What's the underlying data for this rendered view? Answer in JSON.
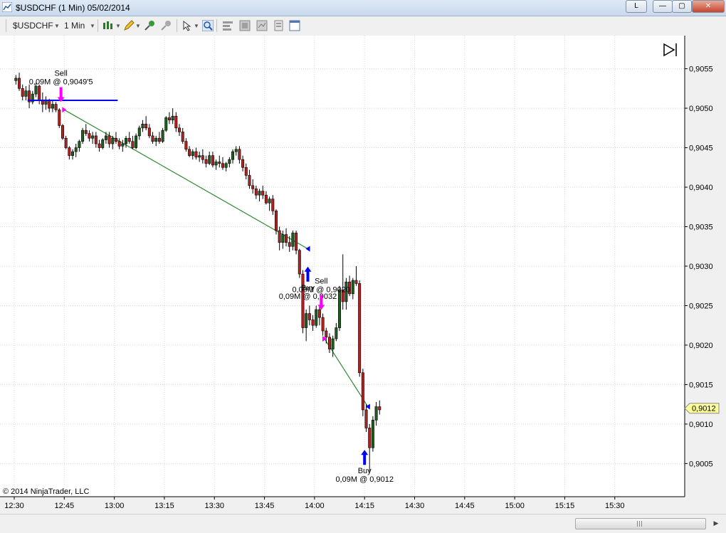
{
  "window": {
    "title": "$USDCHF (1 Min)  05/02/2014",
    "btn_l": "L",
    "btn_min": "—",
    "btn_max": "▢",
    "btn_close": "✕"
  },
  "toolbar": {
    "instrument": "$USDCHF",
    "interval": "1 Min"
  },
  "chart_data": {
    "type": "candlestick",
    "instrument": "$USDCHF",
    "interval": "1 Min",
    "date": "05/02/2014",
    "x_ticks": [
      "12:30",
      "12:45",
      "13:00",
      "13:15",
      "13:30",
      "13:45",
      "14:00",
      "14:15",
      "14:30",
      "14:45",
      "15:00",
      "15:15",
      "15:30"
    ],
    "y_ticks": [
      "0,9055",
      "0,9050",
      "0,9045",
      "0,9040",
      "0,9035",
      "0,9030",
      "0,9025",
      "0,9020",
      "0,9015",
      "0,9010",
      "0,9005"
    ],
    "y_tick_values": [
      0.9055,
      0.905,
      0.9045,
      0.904,
      0.9035,
      0.903,
      0.9025,
      0.902,
      0.9015,
      0.901,
      0.9005
    ],
    "ylim": [
      0.90008,
      0.90592
    ],
    "x_range_minutes": [
      0,
      192
    ],
    "current_price": {
      "label": "0,9012",
      "value": 0.9012
    },
    "grid": true,
    "up_color": "#1f5f1f",
    "down_color": "#b22222",
    "copyright": "© 2014 NinjaTrader, LLC",
    "candles": [
      [
        0.90535,
        0.90542,
        0.9053,
        0.90538
      ],
      [
        0.90538,
        0.90545,
        0.90522,
        0.90525
      ],
      [
        0.90525,
        0.9053,
        0.9051,
        0.90515
      ],
      [
        0.90515,
        0.90528,
        0.9051,
        0.90522
      ],
      [
        0.90522,
        0.9053,
        0.905,
        0.90508
      ],
      [
        0.90508,
        0.90522,
        0.90505,
        0.90518
      ],
      [
        0.90518,
        0.90532,
        0.90514,
        0.90528
      ],
      [
        0.90528,
        0.9053,
        0.90505,
        0.9051
      ],
      [
        0.9051,
        0.9052,
        0.90495,
        0.90505
      ],
      [
        0.90505,
        0.90515,
        0.90498,
        0.9051
      ],
      [
        0.9051,
        0.90512,
        0.90495,
        0.905
      ],
      [
        0.905,
        0.9051,
        0.90495,
        0.90505
      ],
      [
        0.90505,
        0.90508,
        0.90495,
        0.90498
      ],
      [
        0.90498,
        0.905,
        0.90475,
        0.90478
      ],
      [
        0.90478,
        0.9048,
        0.9046,
        0.90462
      ],
      [
        0.90462,
        0.90465,
        0.90448,
        0.9045
      ],
      [
        0.9045,
        0.90452,
        0.90435,
        0.9044
      ],
      [
        0.9044,
        0.90448,
        0.90435,
        0.90445
      ],
      [
        0.90445,
        0.90455,
        0.90438,
        0.9045
      ],
      [
        0.9045,
        0.9046,
        0.90445,
        0.90458
      ],
      [
        0.90458,
        0.90475,
        0.90455,
        0.90472
      ],
      [
        0.90472,
        0.9048,
        0.90465,
        0.90468
      ],
      [
        0.90468,
        0.90472,
        0.90458,
        0.90462
      ],
      [
        0.90462,
        0.9047,
        0.90455,
        0.90465
      ],
      [
        0.90465,
        0.9047,
        0.9045,
        0.90455
      ],
      [
        0.90455,
        0.9046,
        0.90445,
        0.9045
      ],
      [
        0.9045,
        0.90462,
        0.90448,
        0.9046
      ],
      [
        0.9046,
        0.9047,
        0.90455,
        0.90465
      ],
      [
        0.90465,
        0.9047,
        0.9045,
        0.90455
      ],
      [
        0.90455,
        0.90465,
        0.90448,
        0.90462
      ],
      [
        0.90462,
        0.9047,
        0.90455,
        0.90458
      ],
      [
        0.90458,
        0.90462,
        0.90448,
        0.90452
      ],
      [
        0.90452,
        0.9046,
        0.90445,
        0.90455
      ],
      [
        0.90455,
        0.90465,
        0.9045,
        0.90462
      ],
      [
        0.90462,
        0.9047,
        0.90455,
        0.90458
      ],
      [
        0.90458,
        0.90465,
        0.90448,
        0.9045
      ],
      [
        0.9045,
        0.90468,
        0.90448,
        0.90465
      ],
      [
        0.90465,
        0.90478,
        0.9046,
        0.90475
      ],
      [
        0.90475,
        0.90485,
        0.9047,
        0.9048
      ],
      [
        0.9048,
        0.9049,
        0.90472,
        0.90475
      ],
      [
        0.90475,
        0.9048,
        0.90462,
        0.90465
      ],
      [
        0.90465,
        0.9047,
        0.90455,
        0.90458
      ],
      [
        0.90458,
        0.90465,
        0.90452,
        0.90462
      ],
      [
        0.90462,
        0.9047,
        0.90455,
        0.90458
      ],
      [
        0.90458,
        0.90475,
        0.90456,
        0.90472
      ],
      [
        0.90472,
        0.9049,
        0.9047,
        0.90488
      ],
      [
        0.90488,
        0.90495,
        0.9048,
        0.90485
      ],
      [
        0.90485,
        0.905,
        0.9048,
        0.9049
      ],
      [
        0.9049,
        0.90495,
        0.9047,
        0.90475
      ],
      [
        0.90475,
        0.9048,
        0.90465,
        0.9047
      ],
      [
        0.9047,
        0.90475,
        0.90455,
        0.90458
      ],
      [
        0.90458,
        0.90462,
        0.90445,
        0.90448
      ],
      [
        0.90448,
        0.90452,
        0.90438,
        0.9044
      ],
      [
        0.9044,
        0.90448,
        0.90435,
        0.90445
      ],
      [
        0.90445,
        0.9045,
        0.90435,
        0.90438
      ],
      [
        0.90438,
        0.90445,
        0.90432,
        0.9044
      ],
      [
        0.9044,
        0.90448,
        0.9043,
        0.90435
      ],
      [
        0.90435,
        0.9044,
        0.90425,
        0.9043
      ],
      [
        0.9043,
        0.90445,
        0.90428,
        0.9044
      ],
      [
        0.9044,
        0.90445,
        0.90425,
        0.90428
      ],
      [
        0.90428,
        0.90435,
        0.90422,
        0.90432
      ],
      [
        0.90432,
        0.9044,
        0.90425,
        0.9043
      ],
      [
        0.9043,
        0.90438,
        0.90422,
        0.90425
      ],
      [
        0.90425,
        0.90432,
        0.9042,
        0.9043
      ],
      [
        0.9043,
        0.90438,
        0.90425,
        0.90435
      ],
      [
        0.90435,
        0.90448,
        0.9043,
        0.90445
      ],
      [
        0.90445,
        0.90452,
        0.9044,
        0.90448
      ],
      [
        0.90448,
        0.90452,
        0.9043,
        0.90435
      ],
      [
        0.90435,
        0.9044,
        0.9042,
        0.90425
      ],
      [
        0.90425,
        0.9043,
        0.9041,
        0.90415
      ],
      [
        0.90415,
        0.90422,
        0.90398,
        0.90402
      ],
      [
        0.90402,
        0.9041,
        0.90392,
        0.90398
      ],
      [
        0.90398,
        0.90402,
        0.90385,
        0.9039
      ],
      [
        0.9039,
        0.90398,
        0.90382,
        0.90395
      ],
      [
        0.90395,
        0.90402,
        0.90385,
        0.9039
      ],
      [
        0.9039,
        0.90395,
        0.90378,
        0.9038
      ],
      [
        0.9038,
        0.90388,
        0.9037,
        0.90385
      ],
      [
        0.90385,
        0.9039,
        0.90365,
        0.9037
      ],
      [
        0.9037,
        0.90372,
        0.9034,
        0.90345
      ],
      [
        0.90345,
        0.9035,
        0.9032,
        0.9033
      ],
      [
        0.9033,
        0.90345,
        0.90322,
        0.9034
      ],
      [
        0.9034,
        0.90348,
        0.90325,
        0.9033
      ],
      [
        0.9033,
        0.90338,
        0.90318,
        0.90325
      ],
      [
        0.90325,
        0.90345,
        0.9032,
        0.90342
      ],
      [
        0.90342,
        0.90345,
        0.90315,
        0.9032
      ],
      [
        0.9032,
        0.90322,
        0.90285,
        0.9029
      ],
      [
        0.9029,
        0.90295,
        0.90215,
        0.90222
      ],
      [
        0.90222,
        0.90245,
        0.90205,
        0.9024
      ],
      [
        0.9024,
        0.9025,
        0.90225,
        0.90232
      ],
      [
        0.90232,
        0.90238,
        0.90218,
        0.90225
      ],
      [
        0.90225,
        0.9025,
        0.90222,
        0.90245
      ],
      [
        0.90245,
        0.90248,
        0.90225,
        0.90235
      ],
      [
        0.90235,
        0.9024,
        0.90212,
        0.90218
      ],
      [
        0.90218,
        0.90222,
        0.90202,
        0.9021
      ],
      [
        0.9021,
        0.90215,
        0.9019,
        0.90195
      ],
      [
        0.90195,
        0.90212,
        0.90185,
        0.90208
      ],
      [
        0.90208,
        0.90228,
        0.90205,
        0.90222
      ],
      [
        0.90222,
        0.90275,
        0.90218,
        0.9027
      ],
      [
        0.9027,
        0.90315,
        0.90245,
        0.90255
      ],
      [
        0.90255,
        0.90285,
        0.90245,
        0.9028
      ],
      [
        0.9028,
        0.90288,
        0.90262,
        0.90265
      ],
      [
        0.90265,
        0.90285,
        0.90258,
        0.90282
      ],
      [
        0.90282,
        0.903,
        0.90275,
        0.90278
      ],
      [
        0.90278,
        0.90282,
        0.9016,
        0.90165
      ],
      [
        0.90165,
        0.9017,
        0.9011,
        0.90118
      ],
      [
        0.90118,
        0.90125,
        0.9009,
        0.90095
      ],
      [
        0.90095,
        0.901,
        0.9004,
        0.9007
      ],
      [
        0.9007,
        0.9011,
        0.90065,
        0.90105
      ],
      [
        0.90105,
        0.90128,
        0.90098,
        0.90122
      ],
      [
        0.90122,
        0.9013,
        0.90112,
        0.90118
      ]
    ],
    "trades": [
      {
        "side": "Sell",
        "label": "0,09M @ 0,9049'5",
        "time": 14,
        "price": 0.90505
      },
      {
        "side": "Buy",
        "label": "0,09M @ 0,9032",
        "time": 88,
        "price": 0.90302
      },
      {
        "side": "Sell",
        "label": "0,09M @ 0,9020",
        "time": 92,
        "price": 0.90242
      },
      {
        "side": "Buy",
        "label": "0,09M @ 0,9012",
        "time": 105,
        "price": 0.9007
      }
    ],
    "hline": {
      "price": 0.9051,
      "from": 4,
      "to": 31,
      "color": "#0000ff"
    },
    "trade_lines": [
      {
        "from": [
          15,
          0.90498
        ],
        "to": [
          88,
          0.90322
        ]
      },
      {
        "from": [
          93,
          0.90208
        ],
        "to": [
          106,
          0.90122
        ]
      }
    ],
    "entry_markers": [
      {
        "time": 15,
        "price": 0.90498,
        "dir": "right",
        "color": "#ff00ff"
      },
      {
        "time": 88,
        "price": 0.90322,
        "dir": "left",
        "color": "#0000ff"
      },
      {
        "time": 93,
        "price": 0.90208,
        "dir": "right",
        "color": "#ff00ff"
      },
      {
        "time": 106,
        "price": 0.90122,
        "dir": "left",
        "color": "#0000ff"
      }
    ]
  }
}
